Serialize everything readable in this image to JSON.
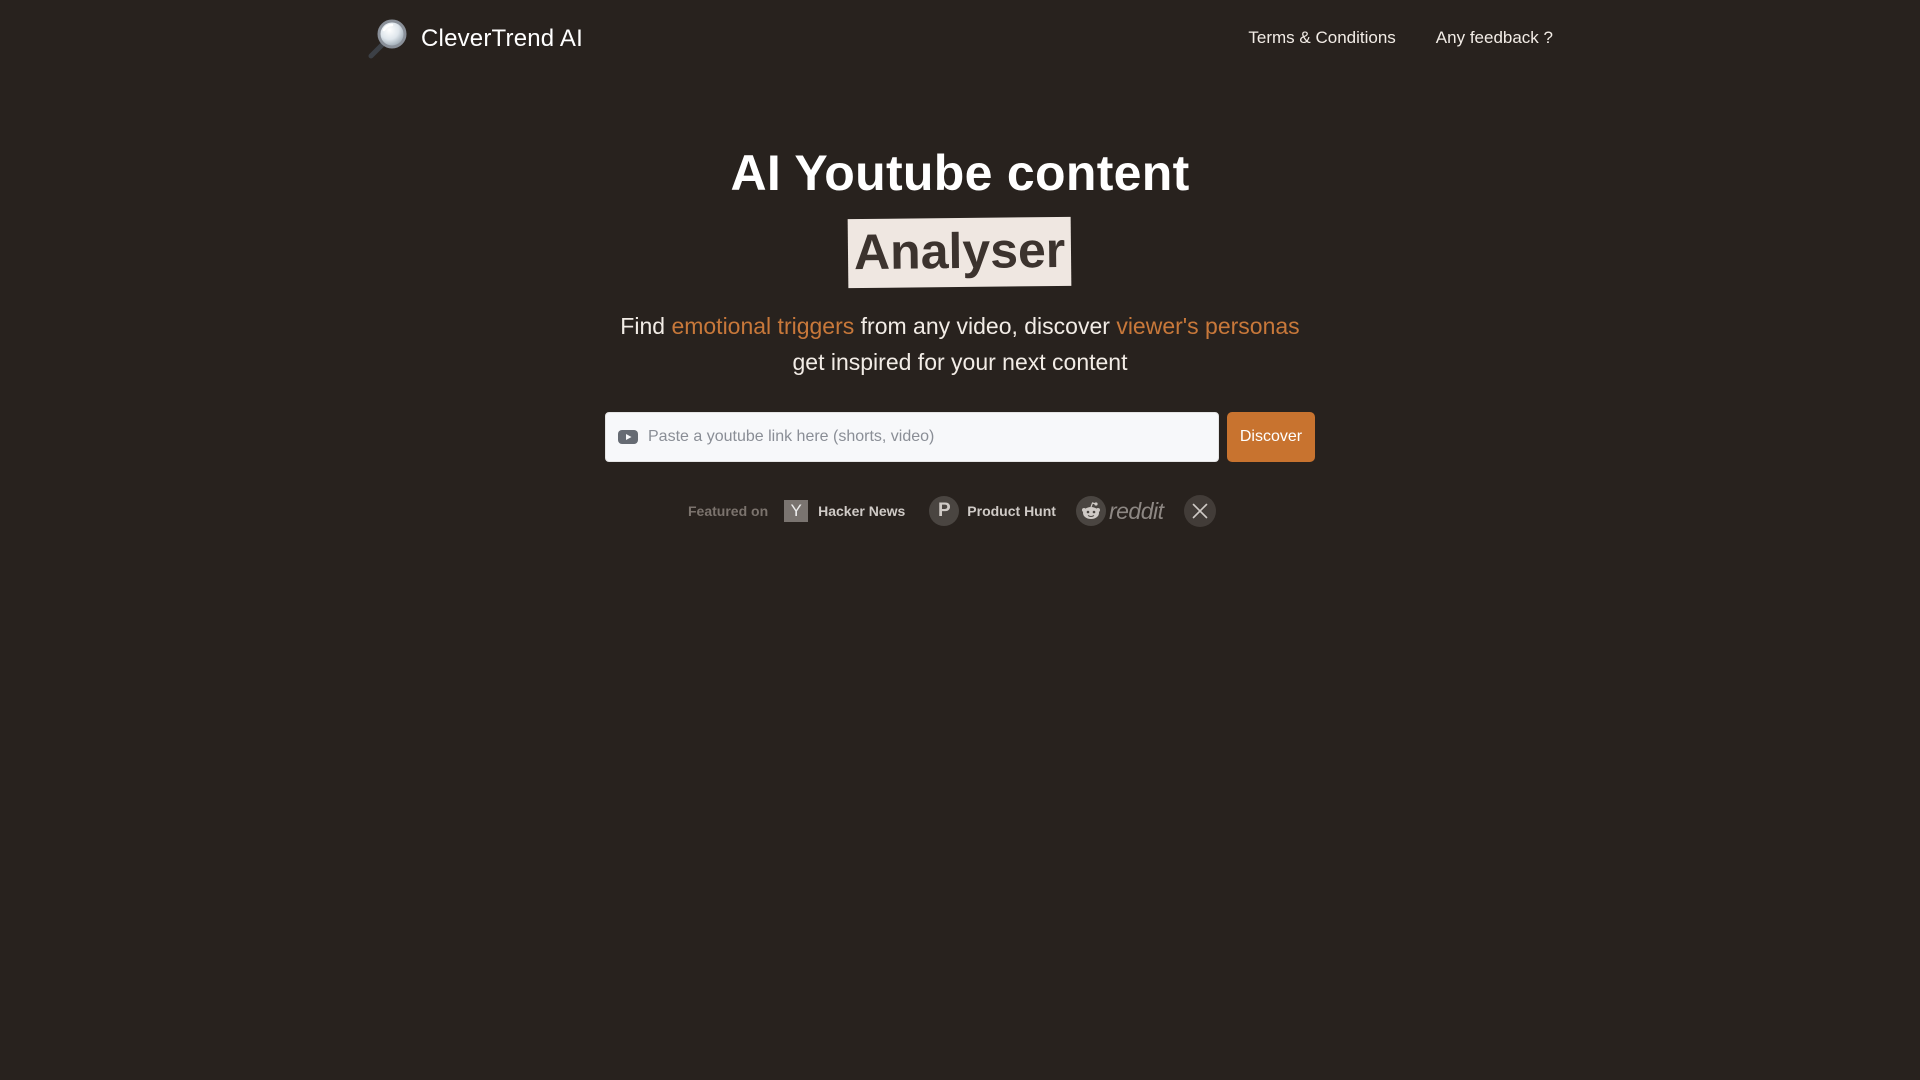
{
  "header": {
    "brand": "CleverTrend AI",
    "nav": [
      {
        "label": "Terms & Conditions"
      },
      {
        "label": "Any feedback ?"
      }
    ]
  },
  "hero": {
    "title": "AI Youtube content",
    "highlight": "Analyser",
    "subtitle": {
      "line1_part1": "Find ",
      "line1_accent1": "emotional triggers",
      "line1_part2": " from any video, discover ",
      "line1_accent2": "viewer's personas",
      "line2": "get inspired for your next content"
    }
  },
  "search": {
    "placeholder": "Paste a youtube link here (shorts, video)",
    "value": "",
    "button_label": "Discover"
  },
  "featured": {
    "label": "Featured on",
    "items": [
      {
        "name": "Hacker News",
        "icon_letter": "Y"
      },
      {
        "name": "Product Hunt",
        "icon_letter": "P"
      },
      {
        "name": "reddit"
      },
      {
        "name": "X"
      }
    ]
  },
  "colors": {
    "background": "#28221e",
    "accent": "#c8783a",
    "button": "#c8732f",
    "highlight_bg": "#efe7e1"
  },
  "icons": {
    "logo": "magnifying-glass-icon",
    "search": "youtube-icon",
    "hacker_news": "hacker-news-icon",
    "product_hunt": "product-hunt-icon",
    "reddit": "reddit-icon",
    "x": "x-icon"
  }
}
